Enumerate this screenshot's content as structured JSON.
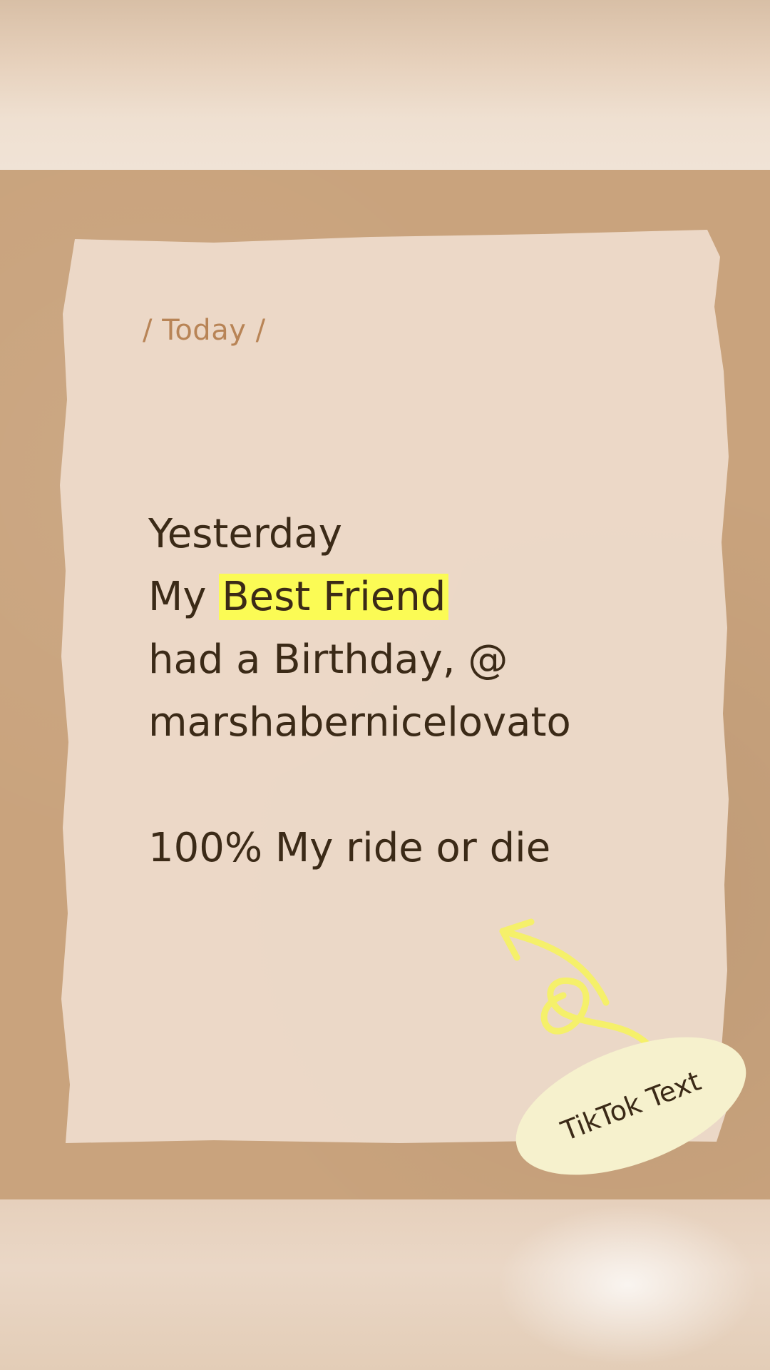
{
  "note": {
    "date_label": "/ Today /",
    "lines": {
      "l1": "Yesterday",
      "l2_pre": "My ",
      "l2_highlight": "Best Friend",
      "l3": "had a Birthday, @",
      "l4": "marshabernicelovato",
      "l5": "100% My ride or die"
    },
    "highlight_color": "#fbfb55"
  },
  "sticker": {
    "label": "TikTok Text"
  },
  "icons": {
    "arrow": "curly-arrow-icon"
  }
}
